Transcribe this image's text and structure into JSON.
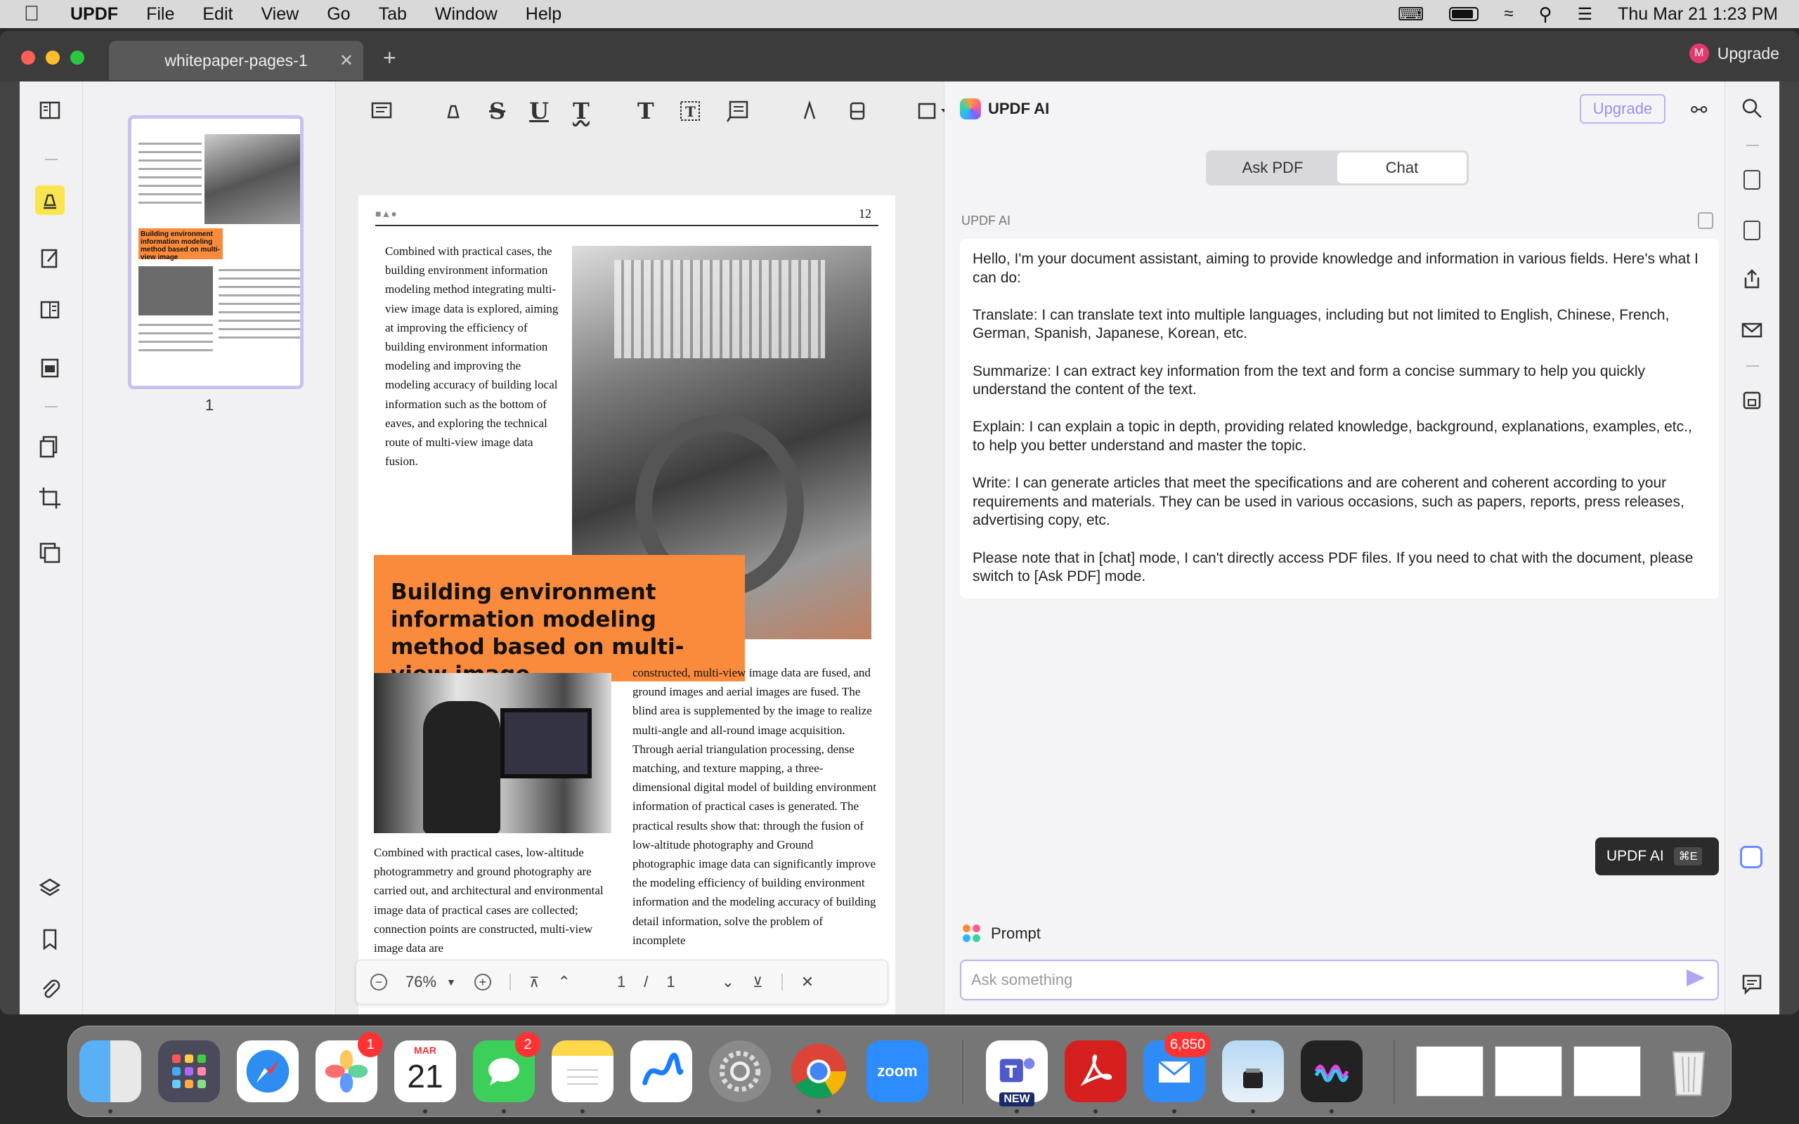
{
  "menubar": {
    "app": "UPDF",
    "items": [
      "File",
      "Edit",
      "View",
      "Go",
      "Tab",
      "Window",
      "Help"
    ],
    "datetime": "Thu Mar 21  1:23 PM"
  },
  "window": {
    "tab_title": "whitepaper-pages-1",
    "upgrade_label": "Upgrade",
    "avatar_letter": "M"
  },
  "thumbnails": {
    "page_number": "1",
    "orange_title": "Building environment information modeling method based on multi-view image"
  },
  "document": {
    "page_number": "12",
    "col1_text": "Combined with practical cases, the building environment information modeling method integrating multi-view image data is explored, aiming at improving the efficiency of building environment information modeling and improving the modeling accuracy of building local information such as the bottom of eaves, and exploring the technical route of multi-view image data fusion.",
    "heading": "Building environment information modeling method based on multi-view image",
    "col_left_text": "Combined with practical cases, low-altitude photogrammetry and ground photography are carried out, and architectural and environmental image data of practical cases are collected; connection points are constructed, multi-view image data are",
    "col_right_text": "constructed, multi-view image data are fused, and ground images and aerial images are fused. The blind area is supplemented by the image to realize multi-angle and all-round image acquisition. Through aerial triangulation processing, dense matching, and texture mapping, a three-dimensional digital model of building environment information of practical cases is generated. The practical results show that: through the fusion of low-altitude photography and Ground photographic image data can significantly improve the modeling efficiency of building environment information and the modeling accuracy of building detail information, solve the problem of incomplete"
  },
  "navbar": {
    "zoom": "76%",
    "current_page": "1",
    "separator": "/",
    "total_pages": "1"
  },
  "ai": {
    "title": "UPDF AI",
    "upgrade": "Upgrade",
    "tabs": [
      "Ask PDF",
      "Chat"
    ],
    "active_tab": "Chat",
    "sender_label": "UPDF AI",
    "message": [
      "Hello, I'm your document assistant, aiming to provide knowledge and information in various fields. Here's what I can do:",
      "Translate: I can translate text into multiple languages, including but not limited to English, Chinese, French, German, Spanish, Japanese, Korean, etc.",
      "Summarize: I can extract key information from the text and form a concise summary to help you quickly understand the content of the text.",
      "Explain: I can explain a topic in depth, providing related knowledge, background, explanations, examples, etc., to help you better understand and master the topic.",
      "Write: I can generate articles that meet the specifications and are coherent and coherent according to your requirements and materials. They can be used in various occasions, such as papers, reports, press releases, advertising copy, etc.",
      "Please note that in [chat] mode, I can't directly access PDF files. If you need to chat with the document, please switch to [Ask PDF] mode."
    ],
    "prompt_label": "Prompt",
    "input_placeholder": "Ask something"
  },
  "tooltip": {
    "label": "UPDF AI",
    "shortcut": "⌘E"
  },
  "dock": {
    "photos_badge": "1",
    "calendar_month": "MAR",
    "calendar_day": "21",
    "messages_badge": "2",
    "zoom_label": "zoom",
    "teams_tag": "NEW",
    "mail_badge": "6,850"
  },
  "colors": {
    "accent": "#b9b2f4",
    "orange": "#fb8b3c",
    "highlight_tool": "#fbe54f"
  }
}
